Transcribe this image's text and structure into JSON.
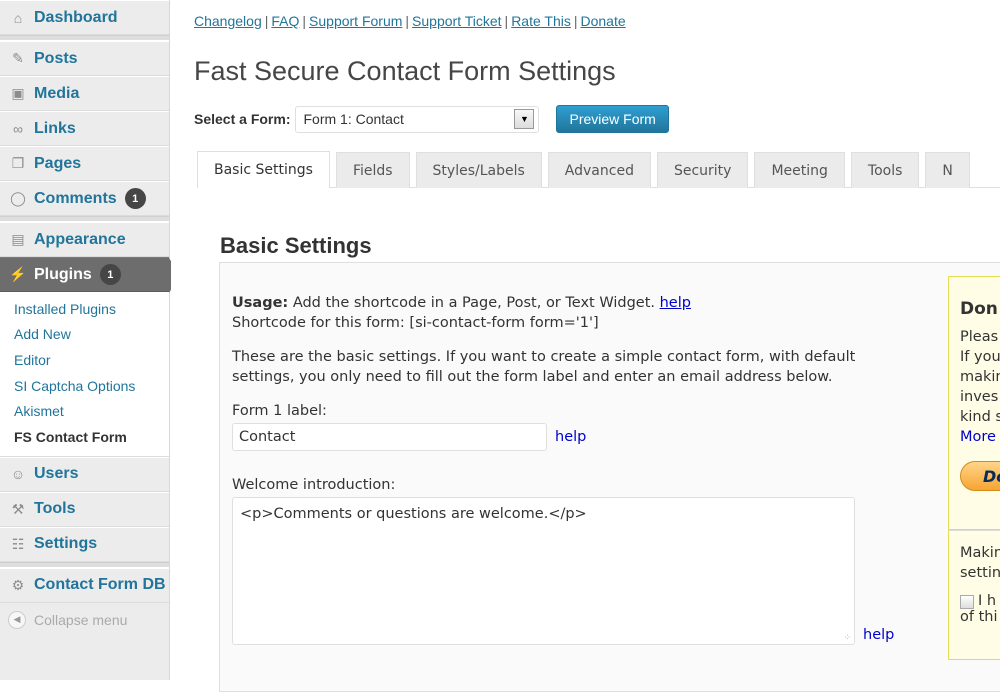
{
  "sidebar": {
    "items": [
      {
        "label": "Dashboard",
        "icon": "home-icon"
      },
      {
        "label": "Posts",
        "icon": "pushpin-icon"
      },
      {
        "label": "Media",
        "icon": "media-icon"
      },
      {
        "label": "Links",
        "icon": "link-icon"
      },
      {
        "label": "Pages",
        "icon": "pages-icon"
      },
      {
        "label": "Comments",
        "icon": "comment-icon",
        "badge": "1"
      },
      {
        "label": "Appearance",
        "icon": "appearance-icon"
      },
      {
        "label": "Plugins",
        "icon": "plug-icon",
        "badge": "1",
        "active": true
      },
      {
        "label": "Users",
        "icon": "users-icon"
      },
      {
        "label": "Tools",
        "icon": "tools-icon"
      },
      {
        "label": "Settings",
        "icon": "settings-icon"
      },
      {
        "label": "Contact Form DB",
        "icon": "gear-icon"
      }
    ],
    "plugins_submenu": [
      {
        "label": "Installed Plugins"
      },
      {
        "label": "Add New"
      },
      {
        "label": "Editor"
      },
      {
        "label": "SI Captcha Options"
      },
      {
        "label": "Akismet"
      },
      {
        "label": "FS Contact Form",
        "current": true
      }
    ],
    "collapse_label": "Collapse menu"
  },
  "toplinks": [
    "Changelog",
    "FAQ",
    "Support Forum",
    "Support Ticket",
    "Rate This",
    "Donate"
  ],
  "page_title": "Fast Secure Contact Form Settings",
  "form_select": {
    "label": "Select a Form:",
    "value": "Form 1: Contact",
    "preview_button": "Preview Form"
  },
  "tabs": [
    "Basic Settings",
    "Fields",
    "Styles/Labels",
    "Advanced",
    "Security",
    "Meeting",
    "Tools",
    "N"
  ],
  "active_tab": "Basic Settings",
  "section": {
    "title": "Basic Settings",
    "usage_label": "Usage:",
    "usage_text": "Add the shortcode in a Page, Post, or Text Widget.",
    "help_link": "help",
    "shortcode_text": "Shortcode for this form: [si-contact-form form='1']",
    "intro_text": "These are the basic settings. If you want to create a simple contact form, with default settings, you only need to fill out the form label and enter an email address below.",
    "form_label_label": "Form 1 label:",
    "form_label_value": "Contact",
    "welcome_label": "Welcome introduction:",
    "welcome_value": "<p>Comments or questions are welcome.</p>"
  },
  "donate": {
    "heading": "Don",
    "lines": [
      "Pleas",
      "If you",
      "makin",
      "inves",
      "kind s"
    ],
    "more": "More",
    "button": "Do",
    "making_lines": [
      "Makin",
      "settin"
    ],
    "checkbox_lines": [
      "I h",
      "of thi"
    ]
  },
  "colors": {
    "link": "#21759b",
    "active_menu": "#6d6d6d",
    "primary_button": "#21759b",
    "help_link": "#0000cc"
  }
}
